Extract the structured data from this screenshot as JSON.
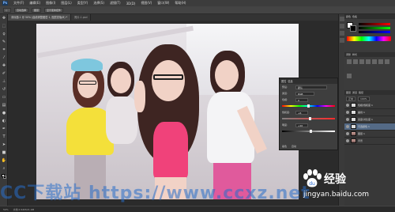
{
  "menubar": {
    "logo": "Ps",
    "items": [
      "文件(F)",
      "编辑(E)",
      "图像(I)",
      "图层(L)",
      "类型(Y)",
      "选择(S)",
      "滤镜(T)",
      "3D(D)",
      "视图(V)",
      "窗口(W)",
      "帮助(H)"
    ]
  },
  "options": [
    "◇",
    "自动选择",
    "图层",
    "显示变换控件"
  ],
  "tabs": [
    {
      "label": "未标题-1 @ 50% (曲线调整图层 1, 图层蒙版/8) *"
    },
    {
      "label": "照片-1.psd"
    }
  ],
  "toolbar": {
    "tools": [
      "move-tool",
      "marquee-tool",
      "lasso-tool",
      "quick-select-tool",
      "crop-tool",
      "eyedropper-tool",
      "healing-tool",
      "brush-tool",
      "stamp-tool",
      "history-brush-tool",
      "eraser-tool",
      "gradient-tool",
      "blur-tool",
      "dodge-tool",
      "pen-tool",
      "type-tool",
      "path-select-tool",
      "shape-tool",
      "hand-tool",
      "zoom-tool"
    ]
  },
  "adjustments_panel": {
    "tabs": [
      "属性",
      "信息"
    ],
    "preset_label": "预设:",
    "preset_value": "默认",
    "channel_label": "通道:",
    "channel_value": "RGB",
    "rows": [
      {
        "label": "色相:",
        "value": "0",
        "level": 0.5
      },
      {
        "label": "饱和度:",
        "value": "+6",
        "level": 0.53
      },
      {
        "label": "明度:",
        "value": "+10",
        "level": 0.55
      }
    ],
    "footer": [
      "着色",
      "自动"
    ]
  },
  "right_panel": {
    "color_tabs": [
      "颜色",
      "色板"
    ],
    "fg_color": "#ffffff",
    "bg_color": "#000000",
    "adjust_tabs": [
      "调整",
      "样式"
    ],
    "layers_tabs": [
      "图层",
      "通道",
      "路径"
    ],
    "blend_mode": "正常",
    "opacity": "100%",
    "layers": [
      {
        "name": "色相/饱和度 1",
        "thumb": "white",
        "selected": false
      },
      {
        "name": "曲线 1",
        "thumb": "white",
        "selected": false
      },
      {
        "name": "亮度/对比度 1",
        "thumb": "white",
        "selected": false
      },
      {
        "name": "可选颜色 1",
        "thumb": "white",
        "selected": true
      },
      {
        "name": "图层 1",
        "thumb": "img",
        "selected": false
      },
      {
        "name": "背景",
        "thumb": "img",
        "selected": false
      }
    ]
  },
  "statusbar": {
    "zoom": "50%",
    "doc_info": "文档:2.64M/21.9M"
  },
  "watermarks": {
    "left": "CC下载站 https://www.ccxz.net",
    "baidu_text": "经验",
    "baidu_url": "jingyan.baidu.com"
  }
}
